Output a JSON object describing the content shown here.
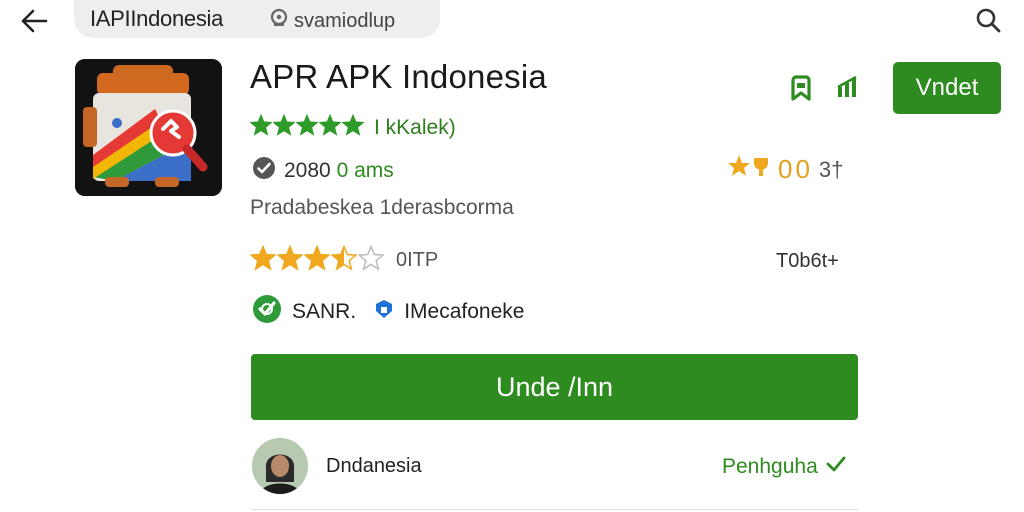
{
  "topbar": {
    "address_title": "IAPIIndonesia",
    "address_sub": "svamiodlup"
  },
  "app": {
    "title": "APR APK Indonesia",
    "rating_sub": "I kKalek)",
    "downloads_prefix": "2080",
    "downloads_suffix": "0 ams",
    "score_value": "00",
    "score_unit": "3†",
    "description": "Pradabeskea 1derasbcorma",
    "rating_label": "0ITP",
    "size_label": "T0b6t+",
    "developer": "SANR.",
    "publisher": "IMecafoneke"
  },
  "actions": {
    "install_top": "Vndet",
    "install_main": "Unde /Inn"
  },
  "review": {
    "reviewer_name": "Dndanesia",
    "follow_label": "Penhguha"
  },
  "colors": {
    "brand_green": "#2e8b1f",
    "star_green": "#2e9a2a",
    "star_gold": "#f0a81e"
  },
  "ratings": {
    "green_stars": 5,
    "gold_stars": 3.5
  }
}
